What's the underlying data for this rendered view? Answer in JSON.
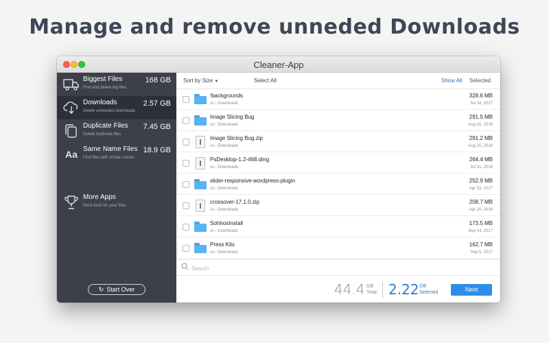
{
  "headline": "Manage and remove unneded Downloads",
  "window": {
    "title": "Cleaner-App"
  },
  "sidebar": {
    "items": [
      {
        "title": "Biggest Files",
        "subtitle": "Find and delete big files",
        "size": "168 GB",
        "icon": "truck-icon",
        "active": false
      },
      {
        "title": "Downloads",
        "subtitle": "Delete unneeded downloads",
        "size": "2.57 GB",
        "icon": "cloud-download-icon",
        "active": true
      },
      {
        "title": "Duplicate Files",
        "subtitle": "Delete duplicate files",
        "size": "7.45 GB",
        "icon": "duplicate-icon",
        "active": false
      },
      {
        "title": "Same Name Files",
        "subtitle": "Find files with similar names",
        "size": "18.9 GB",
        "icon": "text-aa-icon",
        "active": false
      }
    ],
    "more": {
      "title": "More Apps",
      "subtitle": "More tools for your Mac",
      "icon": "trophy-icon"
    },
    "start_over": "Start Over"
  },
  "toolbar": {
    "sort_label": "Sort by Size",
    "select_all": "Select All",
    "show_all": "Show All",
    "selected": "Selected"
  },
  "files": [
    {
      "name": "!backgrounds",
      "owner": "ss",
      "location": "Downloads",
      "size": "328.6 MB",
      "date": "Jul 18, 2017",
      "kind": "folder"
    },
    {
      "name": "Image Slicing Bug",
      "owner": "ss",
      "location": "Downloads",
      "size": "291.5 MB",
      "date": "Aug 15, 2018",
      "kind": "folder"
    },
    {
      "name": "Image Slicing Bug.zip",
      "owner": "ss",
      "location": "Downloads",
      "size": "291.2 MB",
      "date": "Aug 15, 2018",
      "kind": "zip"
    },
    {
      "name": "PsDesktop-1.2-468.dmg",
      "owner": "ss",
      "location": "Downloads",
      "size": "264.4 MB",
      "date": "Jul 31, 2018",
      "kind": "dmg"
    },
    {
      "name": "slider-responsive-wordpress-plugin",
      "owner": "ss",
      "location": "Downloads",
      "size": "252.9 MB",
      "date": "Apr 13, 2017",
      "kind": "folder"
    },
    {
      "name": "crossover-17.1.0.zip",
      "owner": "ss",
      "location": "Downloads",
      "size": "208.7 MB",
      "date": "Apr 20, 2018",
      "kind": "zip"
    },
    {
      "name": "SohhosInstall",
      "owner": "ss",
      "location": "Downloads",
      "size": "173.5 MB",
      "date": "Sep 14, 2017",
      "kind": "folder"
    },
    {
      "name": "Press Kits",
      "owner": "ss",
      "location": "Downloads",
      "size": "162.7 MB",
      "date": "Sep 5, 2017",
      "kind": "folder"
    }
  ],
  "search": {
    "placeholder": "Search",
    "value": ""
  },
  "footer": {
    "total_value": "44.4",
    "total_unit": "GB",
    "total_label": "Total",
    "selected_value": "2.22",
    "selected_unit": "GB",
    "selected_label": "Selected",
    "next_label": "Next"
  },
  "colors": {
    "accent": "#2e8de6",
    "sidebar_bg": "#3b4049",
    "sidebar_active": "#2c3039",
    "folder": "#5ab3ee"
  }
}
